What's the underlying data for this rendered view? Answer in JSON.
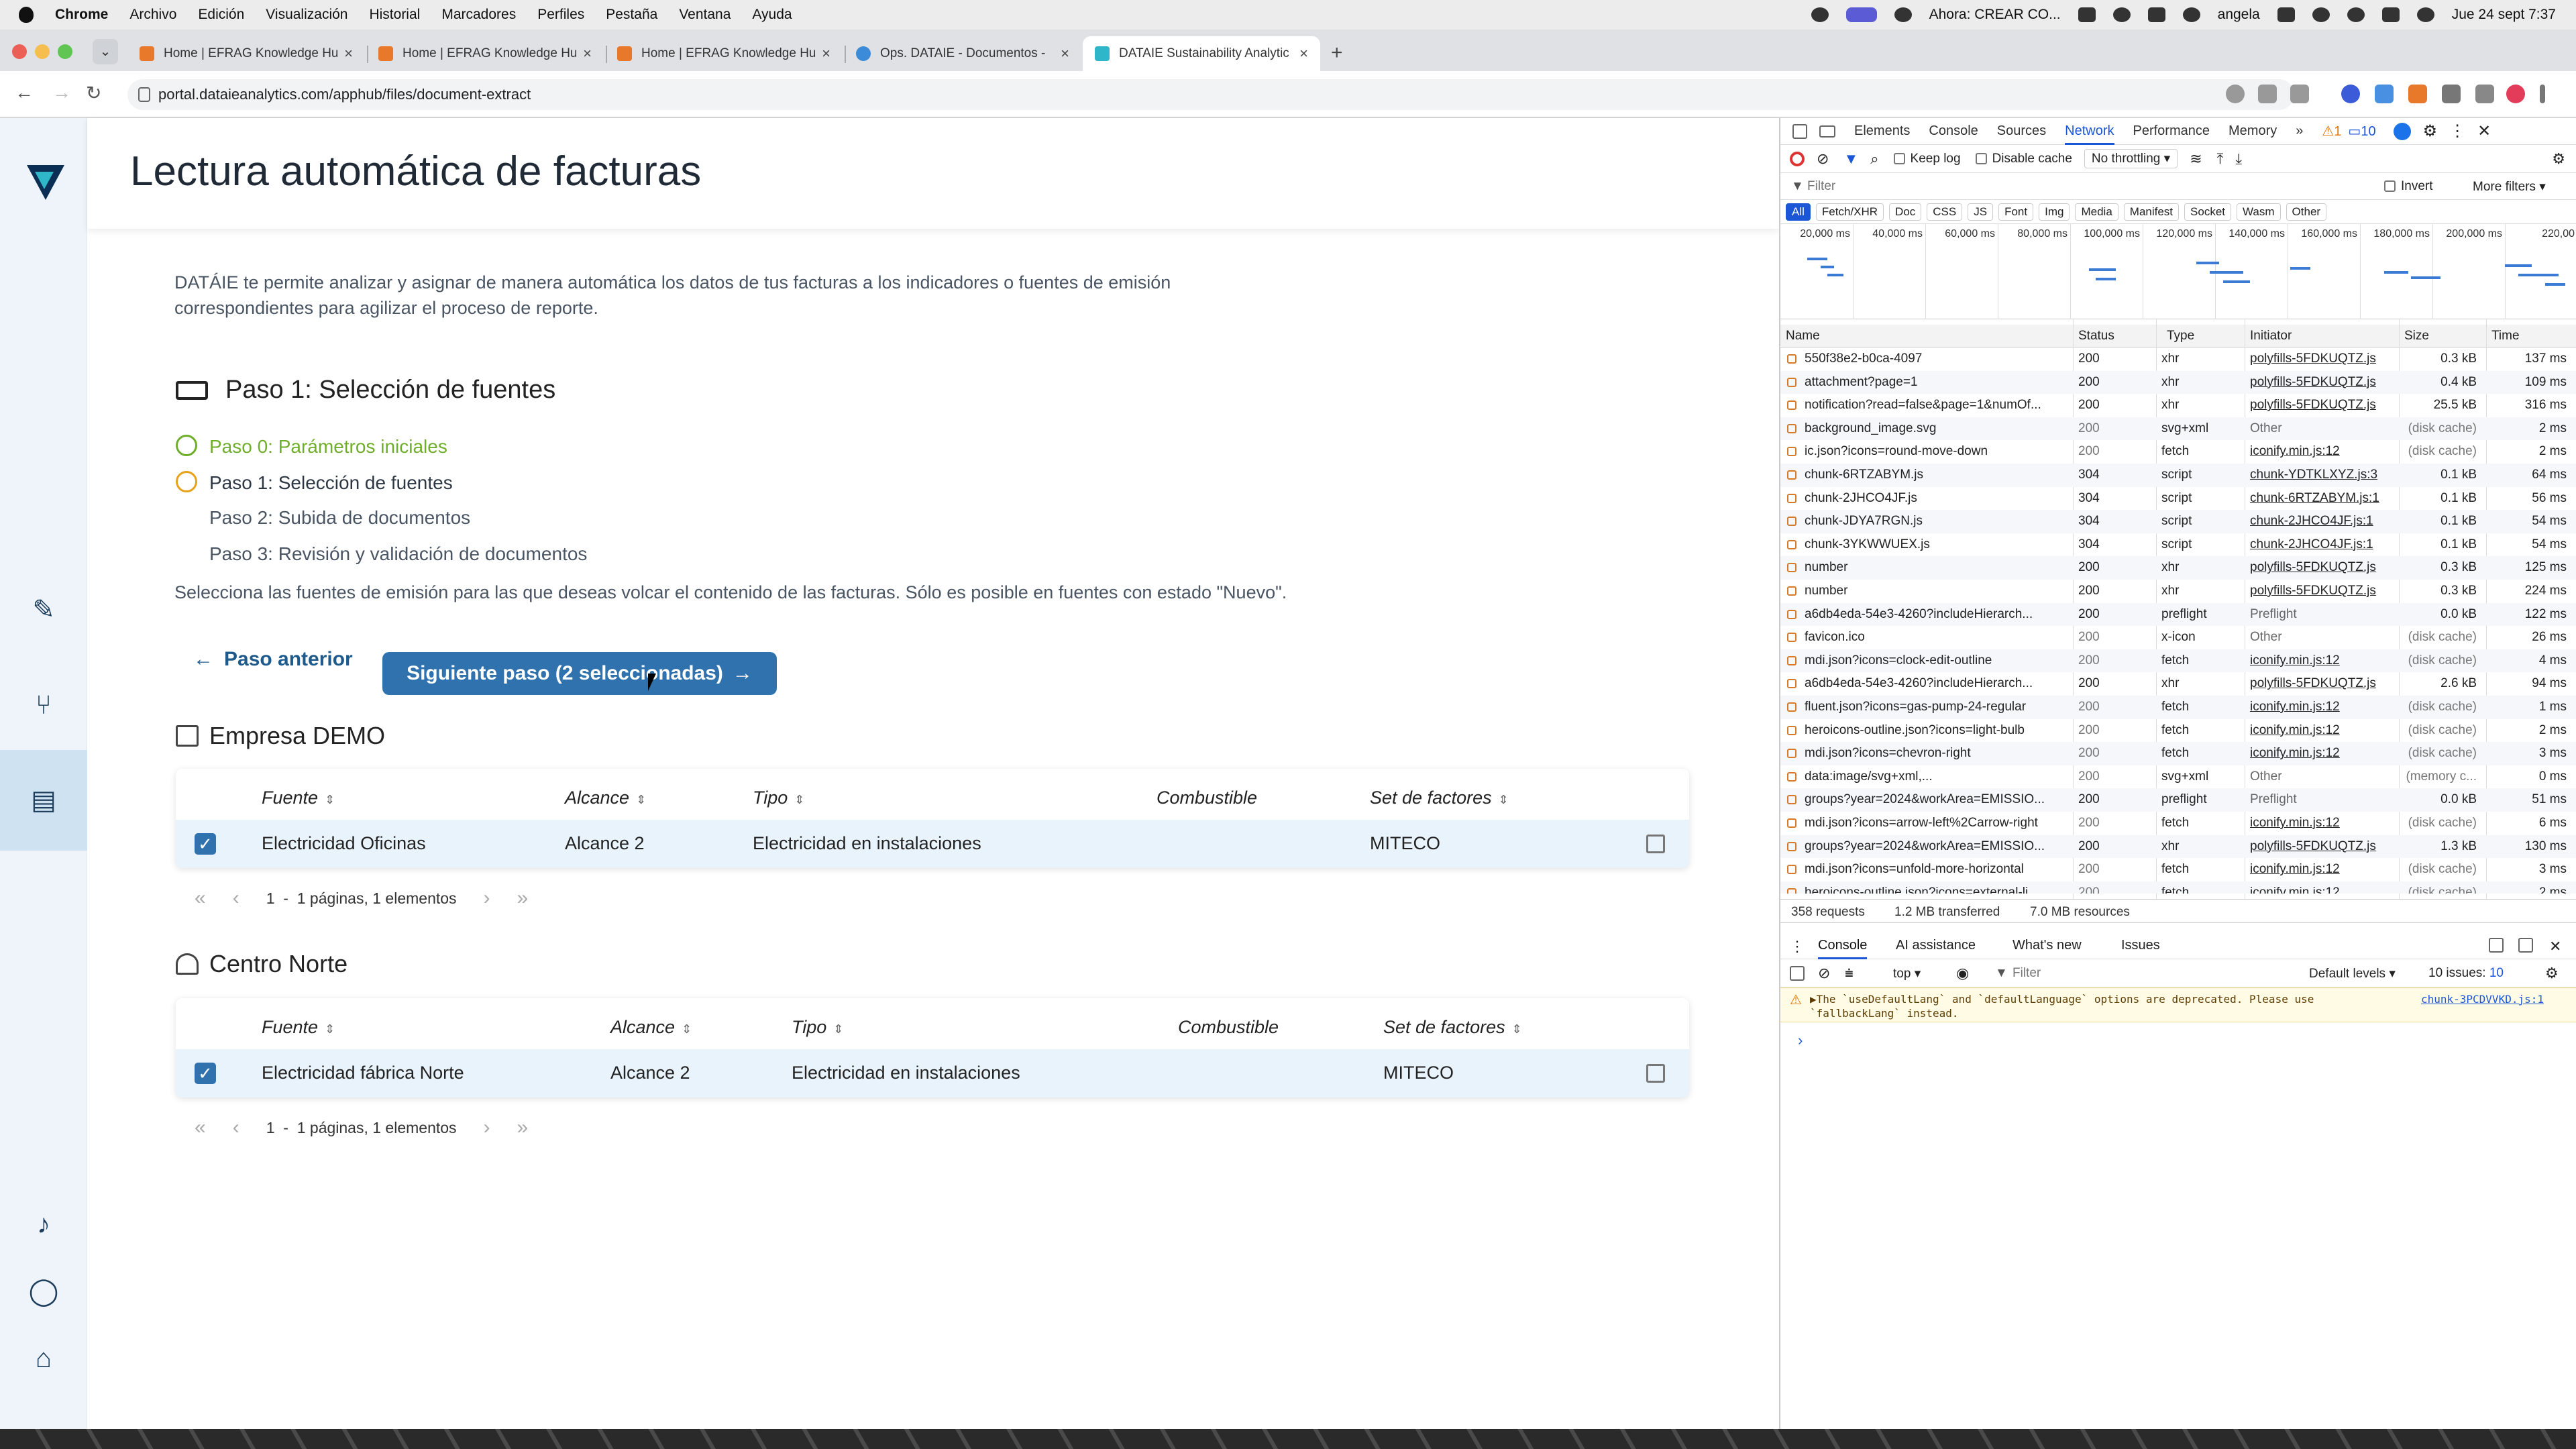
{
  "menubar": {
    "app": "Chrome",
    "items": [
      "Archivo",
      "Edición",
      "Visualización",
      "Historial",
      "Marcadores",
      "Perfiles",
      "Pestaña",
      "Ventana",
      "Ayuda"
    ],
    "now_playing": "Ahora: CREAR CO...",
    "user": "angela",
    "clock": "Jue 24 sept 7:37"
  },
  "browser": {
    "tabs": [
      {
        "title": "Home | EFRAG Knowledge Hu",
        "favicon_color": "#e8792b"
      },
      {
        "title": "Home | EFRAG Knowledge Hu",
        "favicon_color": "#e8792b"
      },
      {
        "title": "Home | EFRAG Knowledge Hu",
        "favicon_color": "#e8792b"
      },
      {
        "title": "Ops. DATAIE - Documentos -",
        "favicon_color": "#3b8bd9"
      },
      {
        "title": "DATAIE Sustainability Analytic",
        "favicon_color": "#2fb6c8"
      }
    ],
    "active_tab": 4,
    "url": "portal.dataieanalytics.com/apphub/files/document-extract",
    "tab_close": "×",
    "new_tab": "+"
  },
  "page": {
    "title": "Lectura automática de facturas",
    "intro": "DATÁIE te permite analizar y asignar de manera automática los datos de tus facturas a los indicadores o fuentes de emisión correspondientes para agilizar el proceso de reporte.",
    "step_heading": "Paso 1: Selección de fuentes",
    "steps": [
      {
        "label": "Paso 0: Parámetros iniciales",
        "state": "done"
      },
      {
        "label": "Paso 1: Selección de fuentes",
        "state": "current"
      },
      {
        "label": "Paso 2: Subida de documentos",
        "state": "pending"
      },
      {
        "label": "Paso 3: Revisión y validación de documentos",
        "state": "pending"
      }
    ],
    "instruction": "Selecciona las fuentes de emisión para las que deseas volcar el contenido de las facturas. Sólo es posible en fuentes con estado \"Nuevo\".",
    "btn_prev": "Paso anterior",
    "btn_next": "Siguiente paso (2 seleccionadas)",
    "columns": {
      "fuente": "Fuente",
      "alcance": "Alcance",
      "tipo": "Tipo",
      "combustible": "Combustible",
      "set": "Set de factores"
    },
    "groups": [
      {
        "name": "Empresa DEMO",
        "row": {
          "fuente": "Electricidad Oficinas",
          "alcance": "Alcance 2",
          "tipo": "Electricidad en instalaciones",
          "combustible": "",
          "set": "MITECO",
          "checked": true
        },
        "pager_page": "1",
        "pager_sep": "-",
        "pager_text": "1 páginas, 1 elementos"
      },
      {
        "name": "Centro Norte",
        "row": {
          "fuente": "Electricidad fábrica Norte",
          "alcance": "Alcance 2",
          "tipo": "Electricidad en instalaciones",
          "combustible": "",
          "set": "MITECO",
          "checked": true
        },
        "pager_page": "1",
        "pager_sep": "-",
        "pager_text": "1 páginas, 1 elementos"
      }
    ]
  },
  "devtools": {
    "tabs": [
      "Elements",
      "Console",
      "Sources",
      "Network",
      "Performance",
      "Memory"
    ],
    "selected_tab": "Network",
    "warnings": "1",
    "messages": "10",
    "keep_log": "Keep log",
    "disable_cache": "Disable cache",
    "throttling": "No throttling",
    "filter_placeholder": "Filter",
    "invert": "Invert",
    "more_filters": "More filters",
    "type_filters": [
      "All",
      "Fetch/XHR",
      "Doc",
      "CSS",
      "JS",
      "Font",
      "Img",
      "Media",
      "Manifest",
      "Socket",
      "Wasm",
      "Other"
    ],
    "overview_ticks": [
      "20,000 ms",
      "40,000 ms",
      "60,000 ms",
      "80,000 ms",
      "100,000 ms",
      "120,000 ms",
      "140,000 ms",
      "160,000 ms",
      "180,000 ms",
      "200,000 ms",
      "220,00"
    ],
    "columns": {
      "name": "Name",
      "status": "Status",
      "type": "Type",
      "initiator": "Initiator",
      "size": "Size",
      "time": "Time"
    },
    "requests": [
      {
        "name": "550f38e2-b0ca-4097",
        "status": "200",
        "type": "xhr",
        "initiator": "polyfills-5FDKUQTZ.js",
        "size": "0.3 kB",
        "time": "137 ms"
      },
      {
        "name": "attachment?page=1",
        "status": "200",
        "type": "xhr",
        "initiator": "polyfills-5FDKUQTZ.js",
        "size": "0.4 kB",
        "time": "109 ms"
      },
      {
        "name": "notification?read=false&page=1&numOf...",
        "status": "200",
        "type": "xhr",
        "initiator": "polyfills-5FDKUQTZ.js",
        "size": "25.5 kB",
        "time": "316 ms"
      },
      {
        "name": "background_image.svg",
        "status": "200",
        "type": "svg+xml",
        "initiator": "Other",
        "size": "(disk cache)",
        "time": "2 ms"
      },
      {
        "name": "ic.json?icons=round-move-down",
        "status": "200",
        "type": "fetch",
        "initiator": "iconify.min.js:12",
        "size": "(disk cache)",
        "time": "2 ms"
      },
      {
        "name": "chunk-6RTZABYM.js",
        "status": "304",
        "type": "script",
        "initiator": "chunk-YDTKLXYZ.js:3",
        "size": "0.1 kB",
        "time": "64 ms"
      },
      {
        "name": "chunk-2JHCO4JF.js",
        "status": "304",
        "type": "script",
        "initiator": "chunk-6RTZABYM.js:1",
        "size": "0.1 kB",
        "time": "56 ms"
      },
      {
        "name": "chunk-JDYA7RGN.js",
        "status": "304",
        "type": "script",
        "initiator": "chunk-2JHCO4JF.js:1",
        "size": "0.1 kB",
        "time": "54 ms"
      },
      {
        "name": "chunk-3YKWWUEX.js",
        "status": "304",
        "type": "script",
        "initiator": "chunk-2JHCO4JF.js:1",
        "size": "0.1 kB",
        "time": "54 ms"
      },
      {
        "name": "number",
        "status": "200",
        "type": "xhr",
        "initiator": "polyfills-5FDKUQTZ.js",
        "size": "0.3 kB",
        "time": "125 ms"
      },
      {
        "name": "number",
        "status": "200",
        "type": "xhr",
        "initiator": "polyfills-5FDKUQTZ.js",
        "size": "0.3 kB",
        "time": "224 ms"
      },
      {
        "name": "a6db4eda-54e3-4260?includeHierarch...",
        "status": "200",
        "type": "preflight",
        "initiator": "Preflight",
        "size": "0.0 kB",
        "time": "122 ms"
      },
      {
        "name": "favicon.ico",
        "status": "200",
        "type": "x-icon",
        "initiator": "Other",
        "size": "(disk cache)",
        "time": "26 ms"
      },
      {
        "name": "mdi.json?icons=clock-edit-outline",
        "status": "200",
        "type": "fetch",
        "initiator": "iconify.min.js:12",
        "size": "(disk cache)",
        "time": "4 ms"
      },
      {
        "name": "a6db4eda-54e3-4260?includeHierarch...",
        "status": "200",
        "type": "xhr",
        "initiator": "polyfills-5FDKUQTZ.js",
        "size": "2.6 kB",
        "time": "94 ms"
      },
      {
        "name": "fluent.json?icons=gas-pump-24-regular",
        "status": "200",
        "type": "fetch",
        "initiator": "iconify.min.js:12",
        "size": "(disk cache)",
        "time": "1 ms"
      },
      {
        "name": "heroicons-outline.json?icons=light-bulb",
        "status": "200",
        "type": "fetch",
        "initiator": "iconify.min.js:12",
        "size": "(disk cache)",
        "time": "2 ms"
      },
      {
        "name": "mdi.json?icons=chevron-right",
        "status": "200",
        "type": "fetch",
        "initiator": "iconify.min.js:12",
        "size": "(disk cache)",
        "time": "3 ms"
      },
      {
        "name": "data:image/svg+xml,...",
        "status": "200",
        "type": "svg+xml",
        "initiator": "Other",
        "size": "(memory c...",
        "time": "0 ms"
      },
      {
        "name": "groups?year=2024&workArea=EMISSIO...",
        "status": "200",
        "type": "preflight",
        "initiator": "Preflight",
        "size": "0.0 kB",
        "time": "51 ms"
      },
      {
        "name": "mdi.json?icons=arrow-left%2Carrow-right",
        "status": "200",
        "type": "fetch",
        "initiator": "iconify.min.js:12",
        "size": "(disk cache)",
        "time": "6 ms"
      },
      {
        "name": "groups?year=2024&workArea=EMISSIO...",
        "status": "200",
        "type": "xhr",
        "initiator": "polyfills-5FDKUQTZ.js",
        "size": "1.3 kB",
        "time": "130 ms"
      },
      {
        "name": "mdi.json?icons=unfold-more-horizontal",
        "status": "200",
        "type": "fetch",
        "initiator": "iconify.min.js:12",
        "size": "(disk cache)",
        "time": "3 ms"
      },
      {
        "name": "heroicons-outline.json?icons=external-li...",
        "status": "200",
        "type": "fetch",
        "initiator": "iconify.min.js:12",
        "size": "(disk cache)",
        "time": "2 ms"
      }
    ],
    "summary_requests": "358 requests",
    "summary_transferred": "1.2 MB transferred",
    "summary_resources": "7.0 MB resources",
    "console_tabs": [
      "Console",
      "AI assistance",
      "What's new",
      "Issues"
    ],
    "console_context": "top",
    "console_filter": "Filter",
    "default_levels": "Default levels",
    "issues": "10 issues:",
    "issues_count": "10",
    "console_warning_line1": "▶The `useDefaultLang` and `defaultLanguage` options are deprecated. Please use",
    "console_warning_line2": "`fallbackLang` instead.",
    "console_warning_source": "chunk-3PCDVVKD.js:1",
    "prompt": "›"
  }
}
